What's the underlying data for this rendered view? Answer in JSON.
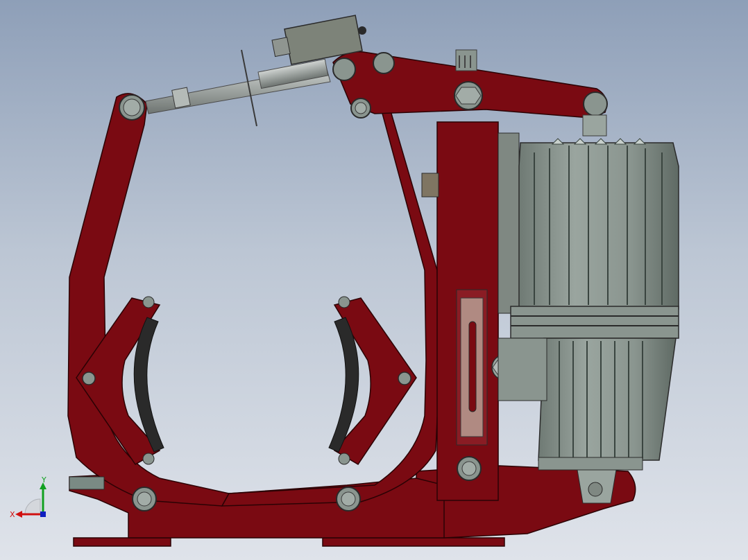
{
  "viewport": {
    "background_top": "#8e9fb8",
    "background_bottom": "#dfe3ea"
  },
  "model": {
    "frame_color": "#7a0a12",
    "frame_dark": "#4a0509",
    "metal_color": "#8f9a94",
    "lining_color": "#2a2a2a"
  },
  "triad": {
    "x_label": "X",
    "y_label": "Y",
    "x_color": "#d01010",
    "y_color": "#10a020",
    "z_color": "#1020c0"
  }
}
